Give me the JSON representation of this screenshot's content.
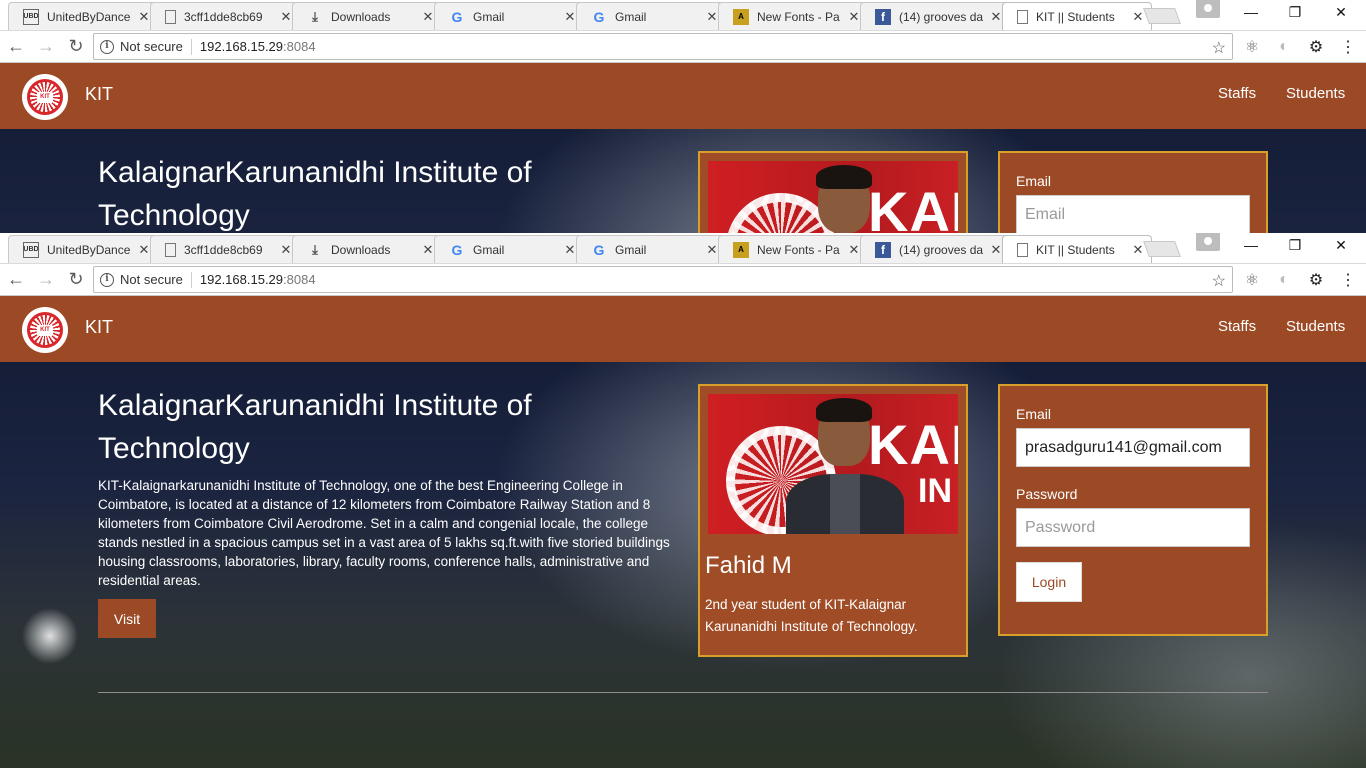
{
  "browser": {
    "tabs": [
      {
        "title": "UnitedByDance",
        "favicon": "UBD",
        "active": false
      },
      {
        "title": "3cff1dde8cb69",
        "favicon": "doc",
        "active": false
      },
      {
        "title": "Downloads",
        "favicon": "download",
        "active": false
      },
      {
        "title": "Gmail",
        "favicon": "G",
        "active": false
      },
      {
        "title": "Gmail",
        "favicon": "G",
        "active": false
      },
      {
        "title": "New Fonts - Pa",
        "favicon": "font",
        "active": false
      },
      {
        "title": "(14) grooves da",
        "favicon": "f",
        "active": false
      },
      {
        "title": "KIT || Students",
        "favicon": "doc",
        "active": true
      }
    ],
    "security_label": "Not secure",
    "url_host": "192.168.15.29",
    "url_port": ":8084"
  },
  "site": {
    "brand": "KIT",
    "nav": [
      "Staffs",
      "Students"
    ],
    "hero": {
      "title": "KalaignarKarunanidhi Institute of Technology",
      "text": "KIT-Kalaignarkarunanidhi Institute of Technology, one of the best Engineering College in Coimbatore, is located at a distance of 12 kilometers from Coimbatore Railway Station and 8 kilometers from Coimbatore Civil Aerodrome. Set in a calm and congenial locale, the college stands nestled in a spacious campus set in a vast area of 5 lakhs sq.ft.with five storied buildings housing classrooms, laboratories, library, faculty rooms, conference halls, administrative and residential areas.",
      "visit_label": "Visit"
    },
    "card": {
      "name": "Fahid M",
      "description": "2nd year student of KIT-Kalaignar Karunanidhi Institute of Technology.",
      "photo_text_1": "KAL",
      "photo_text_2": "IN",
      "logo_text": "KIT"
    },
    "login": {
      "email_label": "Email",
      "email_value": "prasadguru141@gmail.com",
      "email_placeholder": "Email",
      "password_label": "Password",
      "password_placeholder": "Password",
      "login_label": "Login"
    }
  },
  "colors": {
    "brand": "#9b4a25",
    "border_gold": "#d6a02a"
  }
}
